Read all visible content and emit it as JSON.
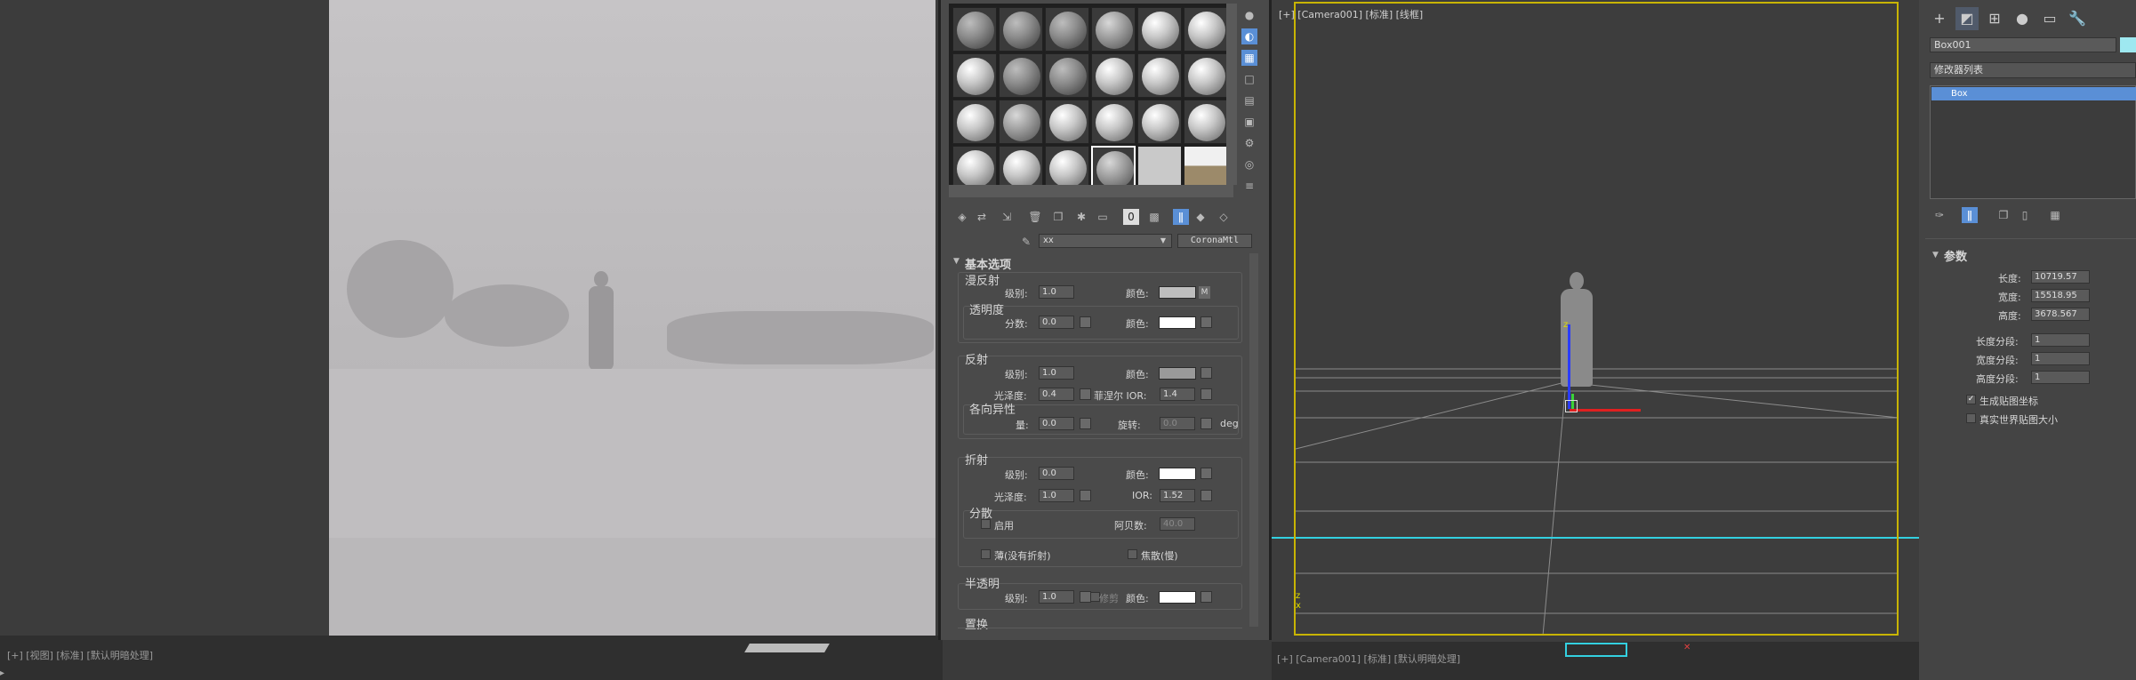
{
  "render_frame": {
    "status_text": "[+] [视图] [标准] [默认明暗处理]"
  },
  "material_editor": {
    "material_name": "xx",
    "material_type": "CoronaMtl",
    "rollout_title": "基本选项",
    "diffuse": {
      "title": "漫反射",
      "level_label": "级别:",
      "level_value": "1.0",
      "color_label": "颜色:",
      "map_label": "M",
      "translucency_title": "透明度",
      "fraction_label": "分数:",
      "fraction_value": "0.0",
      "color2_label": "颜色:"
    },
    "reflection": {
      "title": "反射",
      "level_label": "级别:",
      "level_value": "1.0",
      "color_label": "颜色:",
      "gloss_label": "光泽度:",
      "gloss_value": "0.4",
      "fresnel_label": "菲涅尔 IOR:",
      "fresnel_value": "1.4",
      "aniso_title": "各向异性",
      "amount_label": "量:",
      "amount_value": "0.0",
      "rotation_label": "旋转:",
      "rotation_value": "0.0",
      "rotation_unit": "deg"
    },
    "refraction": {
      "title": "折射",
      "level_label": "级别:",
      "level_value": "0.0",
      "color_label": "颜色:",
      "gloss_label": "光泽度:",
      "gloss_value": "1.0",
      "ior_label": "IOR:",
      "ior_value": "1.52",
      "dispersion_title": "分散",
      "enable_label": "启用",
      "abbe_label": "阿贝数:",
      "abbe_value": "40.0",
      "thin_label": "薄(没有折射)",
      "caustics_label": "焦散(慢)"
    },
    "translucency": {
      "title": "半透明",
      "level_label": "级别:",
      "level_value": "1.0",
      "fraction_label": "修剪",
      "color_label": "颜色:"
    },
    "displacement_title": "置换"
  },
  "viewport": {
    "label": "[+] [Camera001] [标准] [线框]",
    "status": "[+] [Camera001] [标准] [默认明暗处理]",
    "frame_color": "#c8b400"
  },
  "command_panel": {
    "object_name": "Box001",
    "modifier_list_label": "修改器列表",
    "stack_item": "Box",
    "params_title": "参数",
    "length_label": "长度:",
    "length_value": "10719.57",
    "width_label": "宽度:",
    "width_value": "15518.95",
    "height_label": "高度:",
    "height_value": "3678.567",
    "length_segs_label": "长度分段:",
    "length_segs_value": "1",
    "width_segs_label": "宽度分段:",
    "width_segs_value": "1",
    "height_segs_label": "高度分段:",
    "height_segs_value": "1",
    "gen_map_label": "生成贴图坐标",
    "real_world_label": "真实世界贴图大小"
  },
  "colors": {
    "selection_blue": "#5a8fd6",
    "viewport_bg": "#3d3d3d",
    "cyan_line": "#33d0e0"
  }
}
